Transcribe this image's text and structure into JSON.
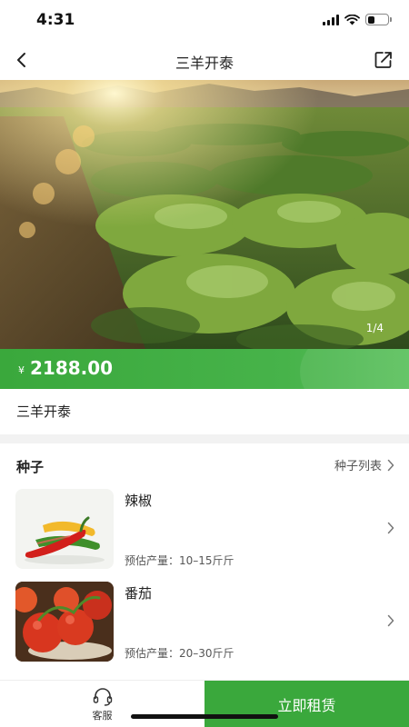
{
  "status_bar": {
    "time": "4:31"
  },
  "nav": {
    "title": "三羊开泰"
  },
  "hero": {
    "page_indicator": "1/4"
  },
  "price": {
    "currency": "¥",
    "value": "2188.00"
  },
  "product": {
    "name": "三羊开泰"
  },
  "seeds": {
    "title": "种子",
    "list_link": "种子列表",
    "items": [
      {
        "name": "辣椒",
        "yield": "预估产量：10–15斤斤"
      },
      {
        "name": "番茄",
        "yield": "预估产量：20–30斤斤"
      }
    ]
  },
  "bottom": {
    "service_label": "客服",
    "rent_label": "立即租赁"
  },
  "colors": {
    "accent": "#3aa83c",
    "background": "#f2f2f2"
  },
  "icons": {
    "back": "chevron-left-icon",
    "share": "share-icon",
    "seeds_list": "chevron-right-icon",
    "service": "headset-icon"
  }
}
